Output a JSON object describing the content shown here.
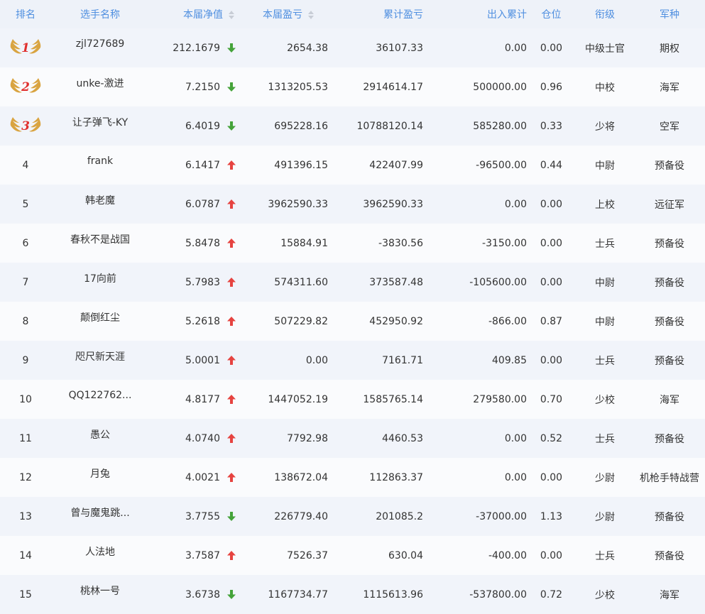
{
  "colors": {
    "header_text": "#4f8fe0",
    "header_bg": "#eef2f9",
    "row_odd": "#f1f4fa",
    "row_even": "#fafbfd",
    "up": "#e64340",
    "down": "#45a33a",
    "medal_wing": "#d9a441",
    "medal_number": "#e0302e"
  },
  "headers": {
    "rank": "排名",
    "name": "选手名称",
    "nav": "本届净值",
    "current_pl": "本届盈亏",
    "cumulative_pl": "累计盈亏",
    "in_out": "出入累计",
    "position": "仓位",
    "grade": "衔级",
    "arm": "军种"
  },
  "rows": [
    {
      "rank": "1",
      "medal": true,
      "name": "zjl727689",
      "nav": "212.1679",
      "trend": "down",
      "current_pl": "2654.38",
      "cumulative_pl": "36107.33",
      "in_out": "0.00",
      "position": "0.00",
      "grade": "中级士官",
      "arm": "期权"
    },
    {
      "rank": "2",
      "medal": true,
      "name": "unke-激进",
      "nav": "7.2150",
      "trend": "down",
      "current_pl": "1313205.53",
      "cumulative_pl": "2914614.17",
      "in_out": "500000.00",
      "position": "0.96",
      "grade": "中校",
      "arm": "海军"
    },
    {
      "rank": "3",
      "medal": true,
      "name": "让子弹飞-KY",
      "nav": "6.4019",
      "trend": "down",
      "current_pl": "695228.16",
      "cumulative_pl": "10788120.14",
      "in_out": "585280.00",
      "position": "0.33",
      "grade": "少将",
      "arm": "空军"
    },
    {
      "rank": "4",
      "medal": false,
      "name": "frank",
      "nav": "6.1417",
      "trend": "up",
      "current_pl": "491396.15",
      "cumulative_pl": "422407.99",
      "in_out": "-96500.00",
      "position": "0.44",
      "grade": "中尉",
      "arm": "预备役"
    },
    {
      "rank": "5",
      "medal": false,
      "name": "韩老魔",
      "nav": "6.0787",
      "trend": "up",
      "current_pl": "3962590.33",
      "cumulative_pl": "3962590.33",
      "in_out": "0.00",
      "position": "0.00",
      "grade": "上校",
      "arm": "远征军"
    },
    {
      "rank": "6",
      "medal": false,
      "name": "春秋不是战国",
      "nav": "5.8478",
      "trend": "up",
      "current_pl": "15884.91",
      "cumulative_pl": "-3830.56",
      "in_out": "-3150.00",
      "position": "0.00",
      "grade": "士兵",
      "arm": "预备役"
    },
    {
      "rank": "7",
      "medal": false,
      "name": "17向前",
      "nav": "5.7983",
      "trend": "up",
      "current_pl": "574311.60",
      "cumulative_pl": "373587.48",
      "in_out": "-105600.00",
      "position": "0.00",
      "grade": "中尉",
      "arm": "预备役"
    },
    {
      "rank": "8",
      "medal": false,
      "name": "颠倒红尘",
      "nav": "5.2618",
      "trend": "up",
      "current_pl": "507229.82",
      "cumulative_pl": "452950.92",
      "in_out": "-866.00",
      "position": "0.87",
      "grade": "中尉",
      "arm": "预备役"
    },
    {
      "rank": "9",
      "medal": false,
      "name": "咫尺新天涯",
      "nav": "5.0001",
      "trend": "up",
      "current_pl": "0.00",
      "cumulative_pl": "7161.71",
      "in_out": "409.85",
      "position": "0.00",
      "grade": "士兵",
      "arm": "预备役"
    },
    {
      "rank": "10",
      "medal": false,
      "name": "QQ122762...",
      "nav": "4.8177",
      "trend": "up",
      "current_pl": "1447052.19",
      "cumulative_pl": "1585765.14",
      "in_out": "279580.00",
      "position": "0.70",
      "grade": "少校",
      "arm": "海军"
    },
    {
      "rank": "11",
      "medal": false,
      "name": "愚公",
      "nav": "4.0740",
      "trend": "up",
      "current_pl": "7792.98",
      "cumulative_pl": "4460.53",
      "in_out": "0.00",
      "position": "0.52",
      "grade": "士兵",
      "arm": "预备役"
    },
    {
      "rank": "12",
      "medal": false,
      "name": "月兔",
      "nav": "4.0021",
      "trend": "up",
      "current_pl": "138672.04",
      "cumulative_pl": "112863.37",
      "in_out": "0.00",
      "position": "0.00",
      "grade": "少尉",
      "arm": "机枪手特战营"
    },
    {
      "rank": "13",
      "medal": false,
      "name": "曾与魔鬼跳...",
      "nav": "3.7755",
      "trend": "down",
      "current_pl": "226779.40",
      "cumulative_pl": "201085.2",
      "in_out": "-37000.00",
      "position": "1.13",
      "grade": "少尉",
      "arm": "预备役"
    },
    {
      "rank": "14",
      "medal": false,
      "name": "人法地",
      "nav": "3.7587",
      "trend": "up",
      "current_pl": "7526.37",
      "cumulative_pl": "630.04",
      "in_out": "-400.00",
      "position": "0.00",
      "grade": "士兵",
      "arm": "预备役"
    },
    {
      "rank": "15",
      "medal": false,
      "name": "桃林一号",
      "nav": "3.6738",
      "trend": "down",
      "current_pl": "1167734.77",
      "cumulative_pl": "1115613.96",
      "in_out": "-537800.00",
      "position": "0.72",
      "grade": "少校",
      "arm": "海军"
    }
  ]
}
